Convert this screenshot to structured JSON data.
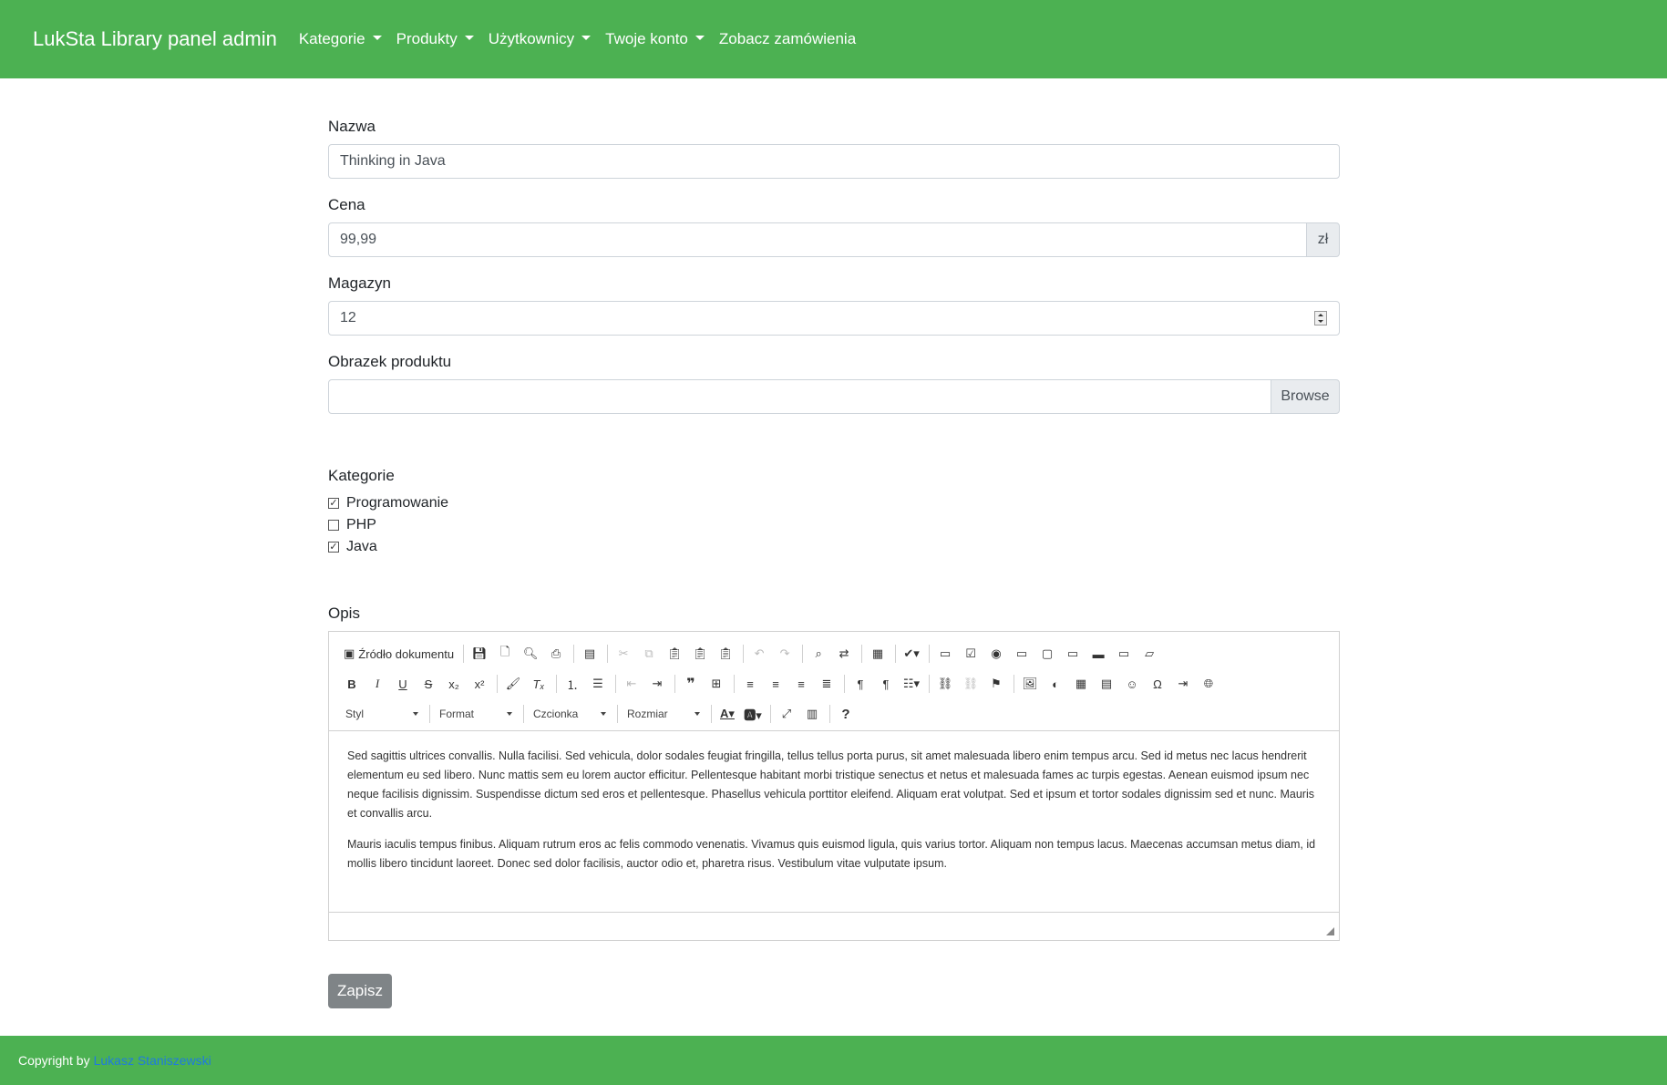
{
  "navbar": {
    "brand": "LukSta Library panel admin",
    "items": [
      {
        "label": "Kategorie",
        "dropdown": true
      },
      {
        "label": "Produkty",
        "dropdown": true
      },
      {
        "label": "Użytkownicy",
        "dropdown": true
      },
      {
        "label": "Twoje konto",
        "dropdown": true
      },
      {
        "label": "Zobacz zamówienia",
        "dropdown": false
      }
    ]
  },
  "form": {
    "name_label": "Nazwa",
    "name_value": "Thinking in Java",
    "price_label": "Cena",
    "price_value": "99,99",
    "price_addon": "zł",
    "stock_label": "Magazyn",
    "stock_value": "12",
    "image_label": "Obrazek produktu",
    "image_value": "",
    "browse_label": "Browse",
    "categories_label": "Kategorie",
    "categories": [
      {
        "label": "Programowanie",
        "checked": true
      },
      {
        "label": "PHP",
        "checked": false
      },
      {
        "label": "Java",
        "checked": true
      }
    ],
    "description_label": "Opis",
    "save_label": "Zapisz"
  },
  "editor": {
    "source_label": "Źródło dokumentu",
    "combos": [
      "Styl",
      "Format",
      "Czcionka",
      "Rozmiar"
    ],
    "toolbar_row1_icons": [
      "save-icon",
      "new-page-icon",
      "preview-icon",
      "print-icon",
      "templates-icon",
      "cut-icon",
      "copy-icon",
      "paste-icon",
      "paste-text-icon",
      "paste-word-icon",
      "undo-icon",
      "redo-icon",
      "find-icon",
      "replace-icon",
      "select-all-icon",
      "spellcheck-icon",
      "form-icon",
      "checkbox-icon",
      "radio-icon",
      "textfield-icon",
      "textarea-icon",
      "select-icon",
      "button-icon",
      "imagebutton-icon",
      "hiddenfield-icon"
    ],
    "toolbar_row2_icons": [
      "bold-icon",
      "italic-icon",
      "underline-icon",
      "strike-icon",
      "subscript-icon",
      "superscript-icon",
      "copy-format-icon",
      "remove-format-icon",
      "numbered-list-icon",
      "bulleted-list-icon",
      "outdent-icon",
      "indent-icon",
      "blockquote-icon",
      "div-icon",
      "align-left-icon",
      "align-center-icon",
      "align-right-icon",
      "justify-icon",
      "ltr-icon",
      "rtl-icon",
      "language-icon",
      "link-icon",
      "unlink-icon",
      "anchor-icon",
      "image-icon",
      "flash-icon",
      "table-icon",
      "horizontal-rule-icon",
      "smiley-icon",
      "special-char-icon",
      "page-break-icon",
      "iframe-icon"
    ],
    "paragraphs": [
      "Sed sagittis ultrices convallis. Nulla facilisi. Sed vehicula, dolor sodales feugiat fringilla, tellus tellus porta purus, sit amet malesuada libero enim tempus arcu. Sed id metus nec lacus hendrerit elementum eu sed libero. Nunc mattis sem eu lorem auctor efficitur. Pellentesque habitant morbi tristique senectus et netus et malesuada fames ac turpis egestas. Aenean euismod ipsum nec neque facilisis dignissim. Suspendisse dictum sed eros et pellentesque. Phasellus vehicula porttitor eleifend. Aliquam erat volutpat. Sed et ipsum et tortor sodales dignissim sed et nunc. Mauris et convallis arcu.",
      "Mauris iaculis tempus finibus. Aliquam rutrum eros ac felis commodo venenatis. Vivamus quis euismod ligula, quis varius tortor. Aliquam non tempus lacus. Maecenas accumsan metus diam, id mollis libero tincidunt laoreet. Donec sed dolor facilisis, auctor odio et, pharetra risus. Vestibulum vitae vulputate ipsum."
    ]
  },
  "footer": {
    "prefix": "Copyright by",
    "author": "Lukasz Staniszewski"
  },
  "colors": {
    "navbar": "#4cb152",
    "footer": "#4cb152",
    "save_button": "#7f8487",
    "footer_link": "#1f7ae0"
  }
}
